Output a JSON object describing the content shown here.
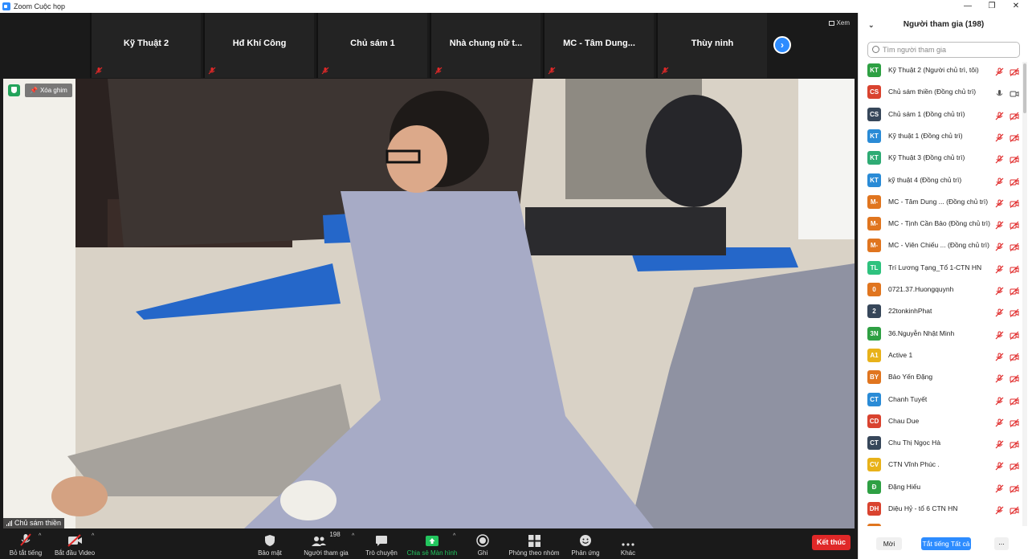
{
  "window": {
    "title": "Zoom Cuộc họp",
    "controls": [
      "—",
      "❐",
      "✕"
    ]
  },
  "view_button": {
    "label": "Xem"
  },
  "thumbnails": [
    {
      "name": "Kỹ Thuật 2"
    },
    {
      "name": "Hđ Khí Công"
    },
    {
      "name": "Chủ sám 1"
    },
    {
      "name": "Nhà chung nữ t..."
    },
    {
      "name": "MC - Tâm Dung..."
    },
    {
      "name": "Thùy ninh"
    }
  ],
  "next_icon": "›",
  "video": {
    "unpin_label": "Xóa ghim",
    "speaker_name": "Chủ sám thiền"
  },
  "toolbar": {
    "mute": "Bỏ tắt tiếng",
    "video": "Bắt đầu Video",
    "security": "Bảo mật",
    "participants": "Người tham gia",
    "participants_count": "198",
    "chat": "Trò chuyện",
    "share": "Chia sẻ Màn hình",
    "record": "Ghi",
    "breakout": "Phòng theo nhóm",
    "reactions": "Phản ứng",
    "more": "Khác",
    "end": "Kết thúc",
    "caret": "^"
  },
  "panel": {
    "title": "Người tham gia (198)",
    "search_placeholder": "Tìm người tham gia",
    "invite": "Mời",
    "mute_all": "Tắt tiếng Tất cả",
    "more": "...",
    "participants": [
      {
        "initials": "KT",
        "color": "#2ea043",
        "name": "Kỹ Thuật 2 (Người chủ trì, tôi)",
        "mic": "muted",
        "cam": "off"
      },
      {
        "initials": "CS",
        "color": "#d9432f",
        "name": "Chủ sám thiền (Đồng chủ trì)",
        "mic": "on",
        "cam": "on"
      },
      {
        "initials": "CS",
        "color": "#37475a",
        "name": "Chủ sám 1 (Đồng chủ trì)",
        "mic": "muted",
        "cam": "off"
      },
      {
        "initials": "KT",
        "color": "#2a8bd6",
        "name": "Kỹ thuật 1 (Đồng chủ trì)",
        "mic": "muted",
        "cam": "off"
      },
      {
        "initials": "KT",
        "color": "#2eab74",
        "name": "Kỹ Thuật 3 (Đồng chủ trì)",
        "mic": "muted",
        "cam": "off"
      },
      {
        "initials": "KT",
        "color": "#2a8bd6",
        "name": "kỹ thuật 4 (Đồng chủ trì)",
        "mic": "muted",
        "cam": "off"
      },
      {
        "initials": "M-",
        "color": "#e0751f",
        "name": "MC - Tâm Dung ... (Đồng chủ trì)",
        "mic": "muted",
        "cam": "off"
      },
      {
        "initials": "M-",
        "color": "#e0751f",
        "name": "MC - Tịnh Cần Bảo (Đồng chủ trì)",
        "mic": "muted",
        "cam": "off"
      },
      {
        "initials": "M-",
        "color": "#e0751f",
        "name": "MC - Viên Chiếu ... (Đồng chủ trì)",
        "mic": "muted",
        "cam": "off"
      },
      {
        "initials": "TL",
        "color": "#2ec27e",
        "name": "Trí Lương Tạng_Tổ 1-CTN HN",
        "mic": "muted",
        "cam": "off"
      },
      {
        "initials": "0",
        "color": "#e0751f",
        "name": "0721.37.Huongquynh",
        "mic": "muted",
        "cam": "off"
      },
      {
        "initials": "2",
        "color": "#37475a",
        "name": "22tonkinhPhat",
        "mic": "muted",
        "cam": "off"
      },
      {
        "initials": "3N",
        "color": "#2ea043",
        "name": "36.Nguyễn Nhật Minh",
        "mic": "muted",
        "cam": "off"
      },
      {
        "initials": "A1",
        "color": "#e8b21a",
        "name": "Active 1",
        "mic": "muted",
        "cam": "off"
      },
      {
        "initials": "BY",
        "color": "#e0751f",
        "name": "Bảo Yến Đặng",
        "mic": "muted",
        "cam": "off"
      },
      {
        "initials": "CT",
        "color": "#2a8bd6",
        "name": "Chanh Tuyết",
        "mic": "muted",
        "cam": "off"
      },
      {
        "initials": "CD",
        "color": "#d9432f",
        "name": "Chau Due",
        "mic": "muted",
        "cam": "off"
      },
      {
        "initials": "CT",
        "color": "#37475a",
        "name": "Chu Thị Ngọc Hà",
        "mic": "muted",
        "cam": "off"
      },
      {
        "initials": "CV",
        "color": "#e8b21a",
        "name": "CTN Vĩnh Phúc .",
        "mic": "muted",
        "cam": "off"
      },
      {
        "initials": "Đ",
        "color": "#2ea043",
        "name": "Đặng Hiếu",
        "mic": "muted",
        "cam": "off"
      },
      {
        "initials": "DH",
        "color": "#d9432f",
        "name": "Diệu Hỷ - tổ 6 CTN HN",
        "mic": "muted",
        "cam": "off"
      },
      {
        "initials": "",
        "color": "#e0751f",
        "name": "",
        "mic": "muted",
        "cam": "off"
      }
    ]
  }
}
